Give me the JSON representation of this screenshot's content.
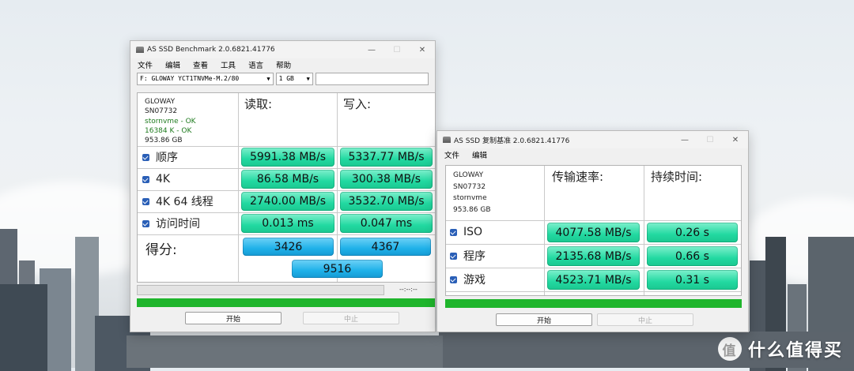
{
  "watermark": {
    "text": "什么值得买",
    "logo": "值"
  },
  "main": {
    "title": "AS SSD Benchmark 2.0.6821.41776",
    "controls": {
      "minimize": "—",
      "maximize": "☐",
      "close": "✕"
    },
    "menu": [
      "文件",
      "编辑",
      "查看",
      "工具",
      "语言",
      "帮助"
    ],
    "drive_select": "F: GLOWAY YCT1TNVMe-M.2/80",
    "size_select": "1 GB",
    "info": {
      "model": "GLOWAY",
      "firmware": "SN07732",
      "driver": "stornvme - OK",
      "align": "16384 K - OK",
      "capacity": "953.86 GB"
    },
    "read_header": "读取:",
    "write_header": "写入:",
    "rows": [
      {
        "label": "顺序",
        "read": "5991.38 MB/s",
        "write": "5337.77 MB/s"
      },
      {
        "label": "4K",
        "read": "86.58 MB/s",
        "write": "300.38 MB/s"
      },
      {
        "label": "4K 64 线程",
        "read": "2740.00 MB/s",
        "write": "3532.70 MB/s"
      },
      {
        "label": "访问时间",
        "read": "0.013 ms",
        "write": "0.047 ms"
      }
    ],
    "score_label": "得分:",
    "score_read": "3426",
    "score_write": "4367",
    "score_total": "9516",
    "time": "--:--:--",
    "start_button": "开始",
    "abort_button": "中止",
    "progress": 1.0
  },
  "copy": {
    "title": "AS SSD 复制基准 2.0.6821.41776",
    "controls": {
      "minimize": "—",
      "maximize": "☐",
      "close": "✕"
    },
    "menu": [
      "文件",
      "编辑"
    ],
    "info": {
      "model": "GLOWAY",
      "firmware": "SN07732",
      "driver": "stornvme",
      "capacity": "953.86 GB"
    },
    "speed_header": "传输速率:",
    "time_header": "持续时间:",
    "rows": [
      {
        "label": "ISO",
        "speed": "4077.58 MB/s",
        "time": "0.26 s"
      },
      {
        "label": "程序",
        "speed": "2135.68 MB/s",
        "time": "0.66 s"
      },
      {
        "label": "游戏",
        "speed": "4523.71 MB/s",
        "time": "0.31 s"
      }
    ],
    "start_button": "开始",
    "abort_button": "中止",
    "progress": 1.0
  }
}
